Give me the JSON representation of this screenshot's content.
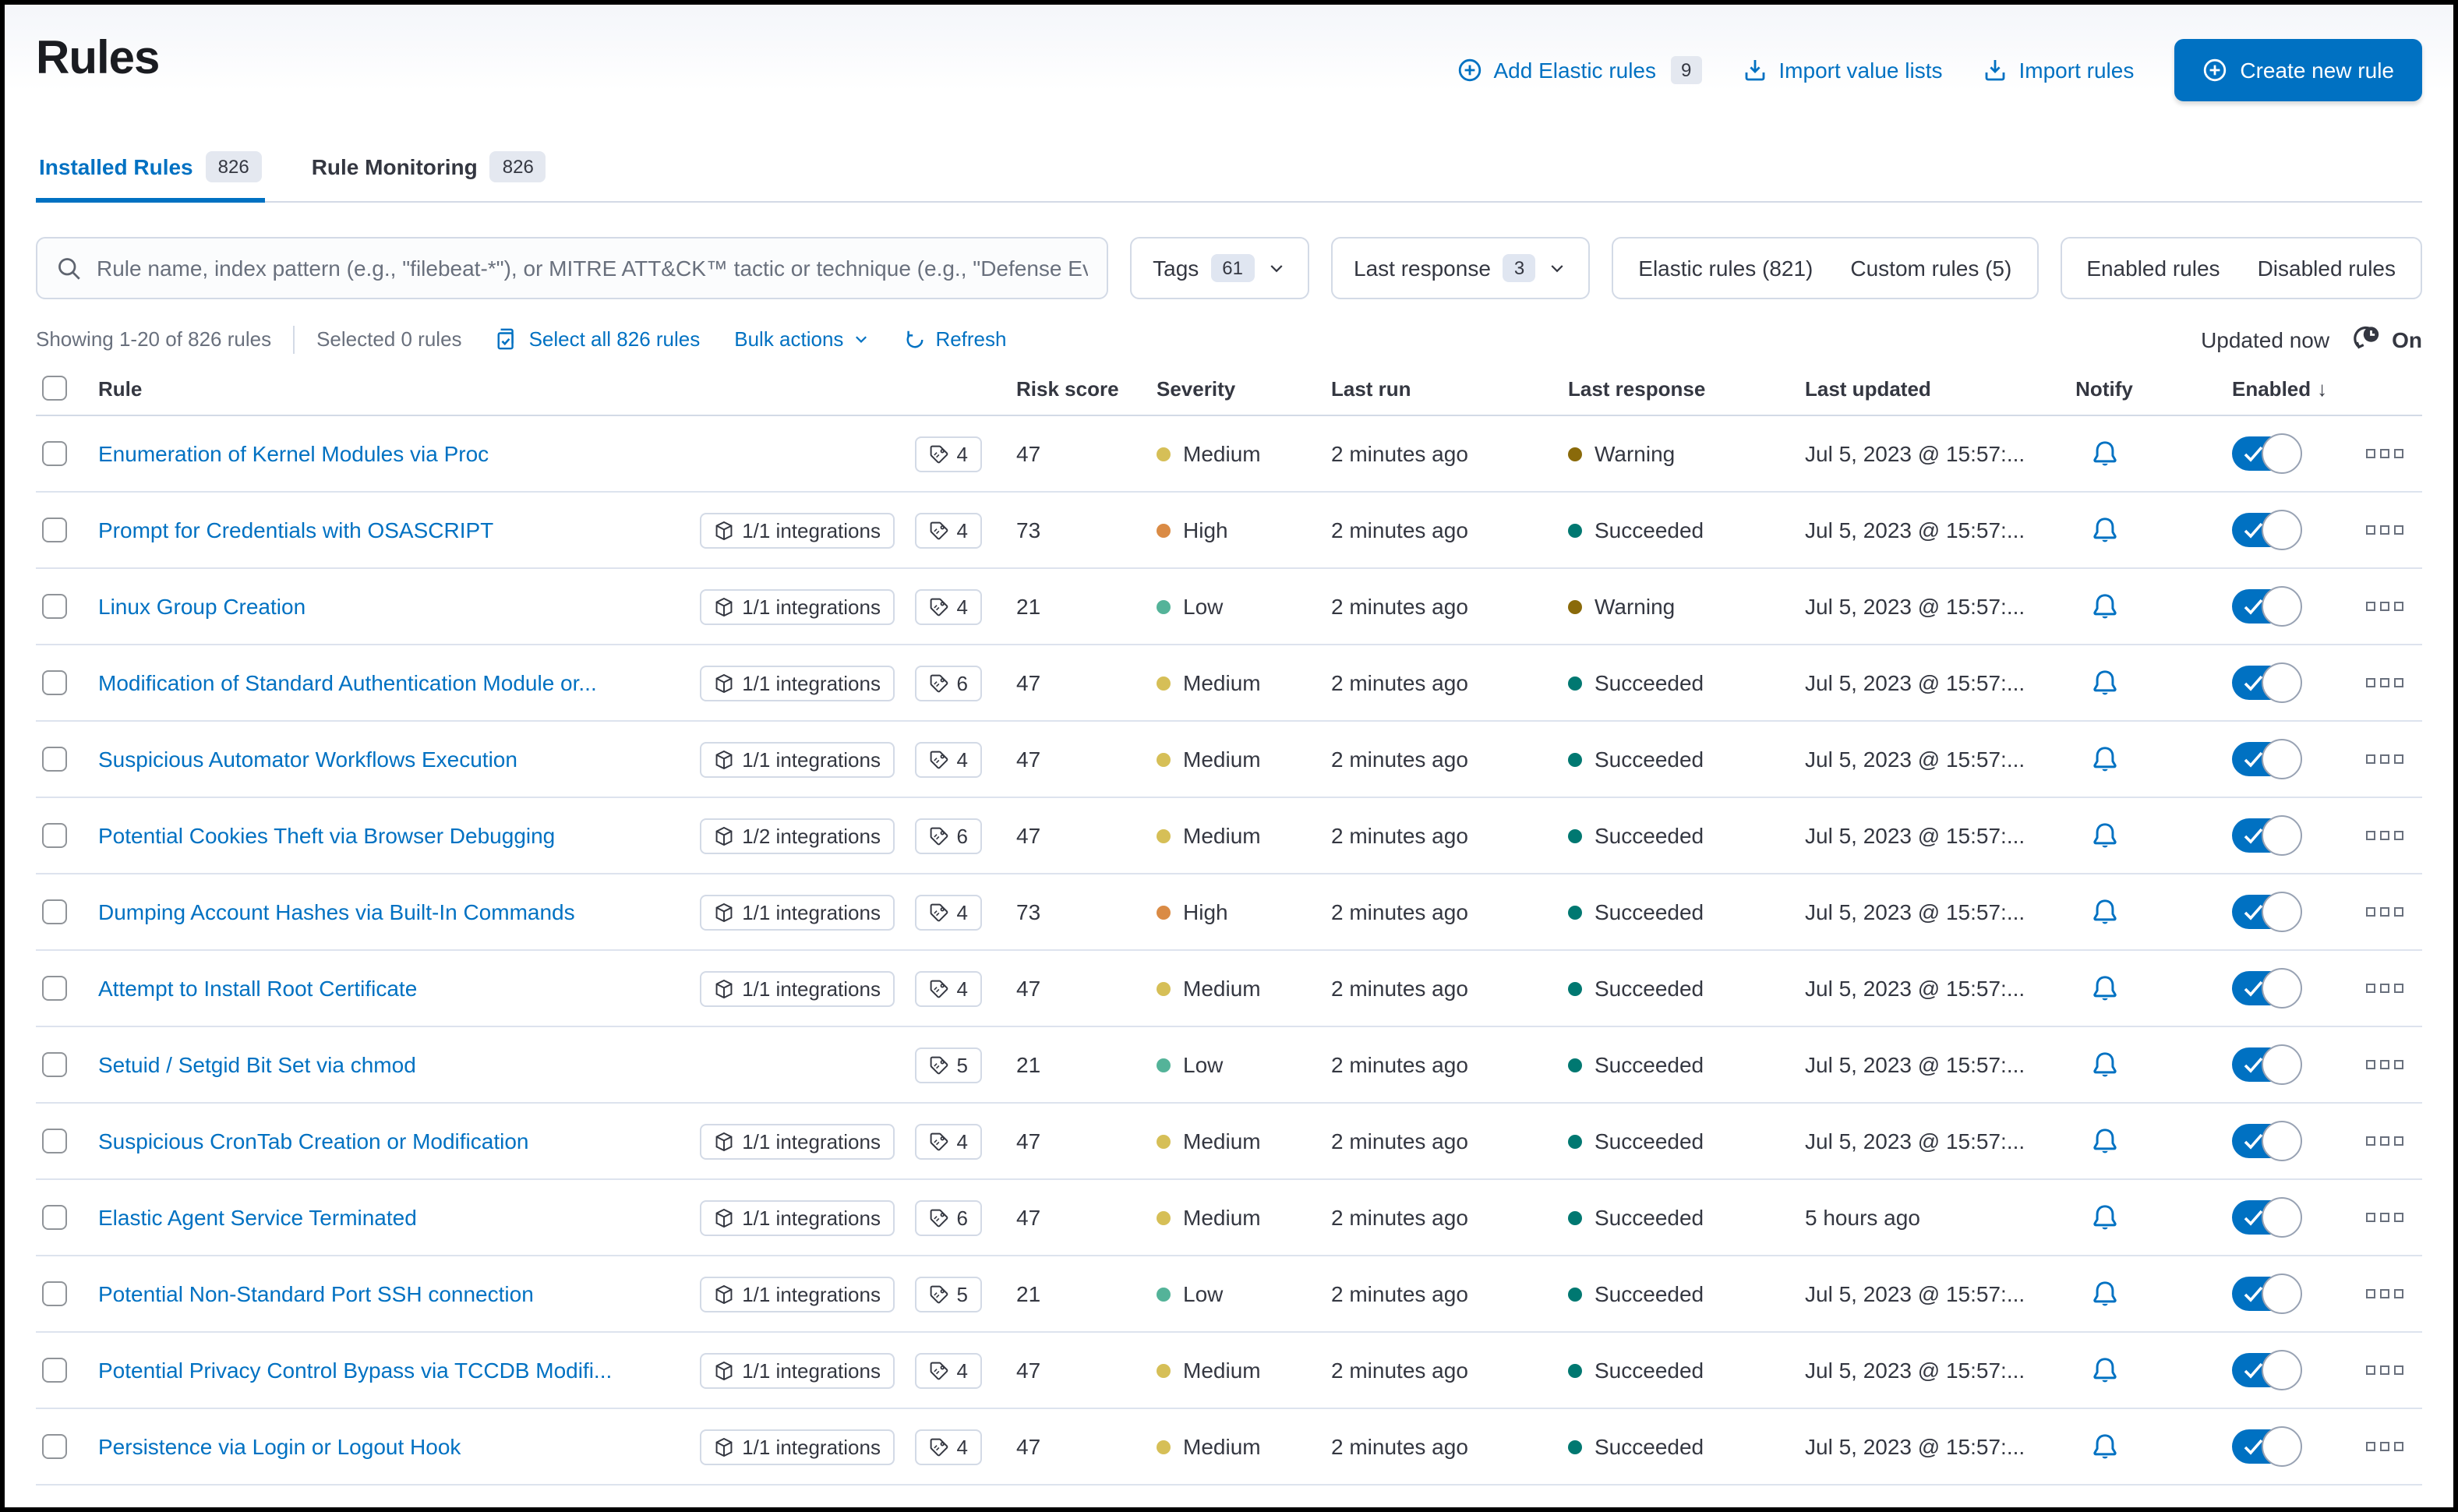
{
  "page": {
    "title": "Rules"
  },
  "header_actions": {
    "add_elastic_rules": "Add Elastic rules",
    "add_badge": "9",
    "import_value_lists": "Import value lists",
    "import_rules": "Import rules",
    "create_new_rule": "Create new rule"
  },
  "tabs": [
    {
      "label": "Installed Rules",
      "count": "826",
      "active": true
    },
    {
      "label": "Rule Monitoring",
      "count": "826",
      "active": false
    }
  ],
  "search": {
    "placeholder": "Rule name, index pattern (e.g., \"filebeat-*\"), or MITRE ATT&CK™ tactic or technique (e.g., \"Defense Ev"
  },
  "filters": {
    "tags_label": "Tags",
    "tags_count": "61",
    "last_response_label": "Last response",
    "last_response_count": "3",
    "elastic_rules": "Elastic rules (821)",
    "custom_rules": "Custom rules (5)",
    "enabled_rules": "Enabled rules",
    "disabled_rules": "Disabled rules"
  },
  "utility": {
    "showing": "Showing 1-20 of 826 rules",
    "selected": "Selected 0 rules",
    "select_all": "Select all 826 rules",
    "bulk_actions": "Bulk actions",
    "refresh": "Refresh",
    "updated": "Updated now",
    "auto_refresh": "On"
  },
  "table": {
    "columns": [
      "Rule",
      "Risk score",
      "Severity",
      "Last run",
      "Last response",
      "Last updated",
      "Notify",
      "Enabled"
    ],
    "rows": [
      {
        "name": "Enumeration of Kernel Modules via Proc",
        "integrations": null,
        "tags": "4",
        "risk": "47",
        "severity": "Medium",
        "last_run": "2 minutes ago",
        "last_response": "Warning",
        "last_updated": "Jul 5, 2023 @ 15:57:...",
        "notify": true,
        "enabled": true
      },
      {
        "name": "Prompt for Credentials with OSASCRIPT",
        "integrations": "1/1 integrations",
        "tags": "4",
        "risk": "73",
        "severity": "High",
        "last_run": "2 minutes ago",
        "last_response": "Succeeded",
        "last_updated": "Jul 5, 2023 @ 15:57:...",
        "notify": true,
        "enabled": true
      },
      {
        "name": "Linux Group Creation",
        "integrations": "1/1 integrations",
        "tags": "4",
        "risk": "21",
        "severity": "Low",
        "last_run": "2 minutes ago",
        "last_response": "Warning",
        "last_updated": "Jul 5, 2023 @ 15:57:...",
        "notify": true,
        "enabled": true
      },
      {
        "name": "Modification of Standard Authentication Module or...",
        "integrations": "1/1 integrations",
        "tags": "6",
        "risk": "47",
        "severity": "Medium",
        "last_run": "2 minutes ago",
        "last_response": "Succeeded",
        "last_updated": "Jul 5, 2023 @ 15:57:...",
        "notify": true,
        "enabled": true
      },
      {
        "name": "Suspicious Automator Workflows Execution",
        "integrations": "1/1 integrations",
        "tags": "4",
        "risk": "47",
        "severity": "Medium",
        "last_run": "2 minutes ago",
        "last_response": "Succeeded",
        "last_updated": "Jul 5, 2023 @ 15:57:...",
        "notify": true,
        "enabled": true
      },
      {
        "name": "Potential Cookies Theft via Browser Debugging",
        "integrations": "1/2 integrations",
        "tags": "6",
        "risk": "47",
        "severity": "Medium",
        "last_run": "2 minutes ago",
        "last_response": "Succeeded",
        "last_updated": "Jul 5, 2023 @ 15:57:...",
        "notify": true,
        "enabled": true
      },
      {
        "name": "Dumping Account Hashes via Built-In Commands",
        "integrations": "1/1 integrations",
        "tags": "4",
        "risk": "73",
        "severity": "High",
        "last_run": "2 minutes ago",
        "last_response": "Succeeded",
        "last_updated": "Jul 5, 2023 @ 15:57:...",
        "notify": true,
        "enabled": true
      },
      {
        "name": "Attempt to Install Root Certificate",
        "integrations": "1/1 integrations",
        "tags": "4",
        "risk": "47",
        "severity": "Medium",
        "last_run": "2 minutes ago",
        "last_response": "Succeeded",
        "last_updated": "Jul 5, 2023 @ 15:57:...",
        "notify": true,
        "enabled": true
      },
      {
        "name": "Setuid / Setgid Bit Set via chmod",
        "integrations": null,
        "tags": "5",
        "risk": "21",
        "severity": "Low",
        "last_run": "2 minutes ago",
        "last_response": "Succeeded",
        "last_updated": "Jul 5, 2023 @ 15:57:...",
        "notify": true,
        "enabled": true
      },
      {
        "name": "Suspicious CronTab Creation or Modification",
        "integrations": "1/1 integrations",
        "tags": "4",
        "risk": "47",
        "severity": "Medium",
        "last_run": "2 minutes ago",
        "last_response": "Succeeded",
        "last_updated": "Jul 5, 2023 @ 15:57:...",
        "notify": true,
        "enabled": true
      },
      {
        "name": "Elastic Agent Service Terminated",
        "integrations": "1/1 integrations",
        "tags": "6",
        "risk": "47",
        "severity": "Medium",
        "last_run": "2 minutes ago",
        "last_response": "Succeeded",
        "last_updated": "5 hours ago",
        "notify": true,
        "enabled": true
      },
      {
        "name": "Potential Non-Standard Port SSH connection",
        "integrations": "1/1 integrations",
        "tags": "5",
        "risk": "21",
        "severity": "Low",
        "last_run": "2 minutes ago",
        "last_response": "Succeeded",
        "last_updated": "Jul 5, 2023 @ 15:57:...",
        "notify": true,
        "enabled": true
      },
      {
        "name": "Potential Privacy Control Bypass via TCCDB Modifi...",
        "integrations": "1/1 integrations",
        "tags": "4",
        "risk": "47",
        "severity": "Medium",
        "last_run": "2 minutes ago",
        "last_response": "Succeeded",
        "last_updated": "Jul 5, 2023 @ 15:57:...",
        "notify": true,
        "enabled": true
      },
      {
        "name": "Persistence via Login or Logout Hook",
        "integrations": "1/1 integrations",
        "tags": "4",
        "risk": "47",
        "severity": "Medium",
        "last_run": "2 minutes ago",
        "last_response": "Succeeded",
        "last_updated": "Jul 5, 2023 @ 15:57:...",
        "notify": true,
        "enabled": true
      }
    ]
  },
  "colors": {
    "accent": "#0071c2",
    "severity": {
      "Medium": "#d6bf57",
      "High": "#da8b45",
      "Low": "#54b399",
      "Critical": "#e7664c"
    },
    "response": {
      "Succeeded": "#007871",
      "Warning": "#8a6a0a",
      "Failed": "#bd271e"
    }
  }
}
